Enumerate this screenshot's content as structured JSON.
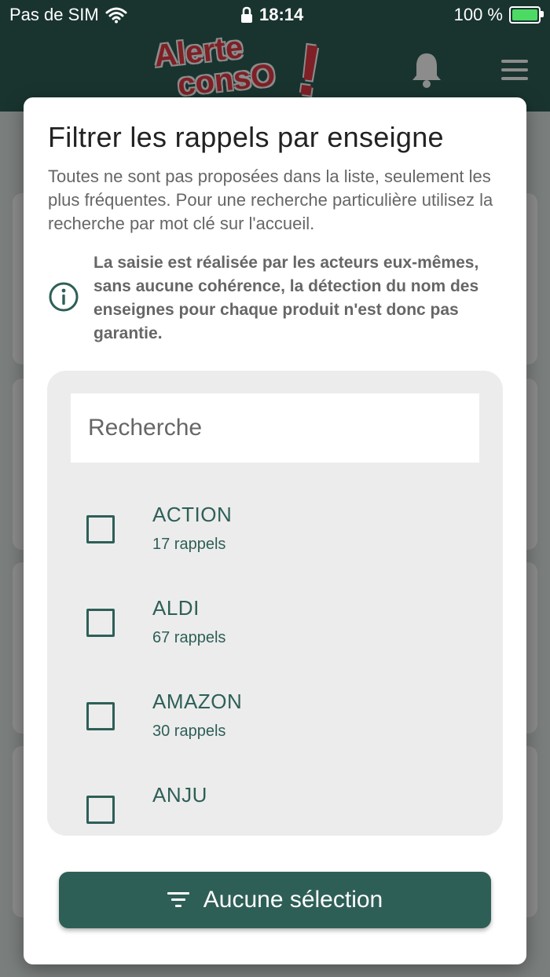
{
  "status_bar": {
    "carrier": "Pas de SIM",
    "time": "18:14",
    "battery": "100 %"
  },
  "header": {
    "logo_line1": "Alerte",
    "logo_line2": "consO",
    "logo_mark": "!"
  },
  "colors": {
    "primary": "#2e5f57",
    "logo_red": "#e63b45",
    "battery_green": "#4cd964"
  },
  "dialog": {
    "title": "Filtrer les rappels par enseigne",
    "description": "Toutes ne sont pas proposées dans la liste, seulement les plus fréquentes. Pour une recherche particulière utilisez la recherche par mot clé sur l'accueil.",
    "info_text": "La saisie est réalisée par les acteurs eux-mêmes, sans aucune cohérence, la détection du nom des enseignes pour chaque produit n'est donc pas garantie.",
    "search_placeholder": "Recherche",
    "stores": [
      {
        "name": "ACTION",
        "count": "17 rappels"
      },
      {
        "name": "ALDI",
        "count": "67 rappels"
      },
      {
        "name": "AMAZON",
        "count": "30 rappels"
      },
      {
        "name": "ANJU",
        "count": ""
      }
    ],
    "apply_label": "Aucune sélection"
  }
}
